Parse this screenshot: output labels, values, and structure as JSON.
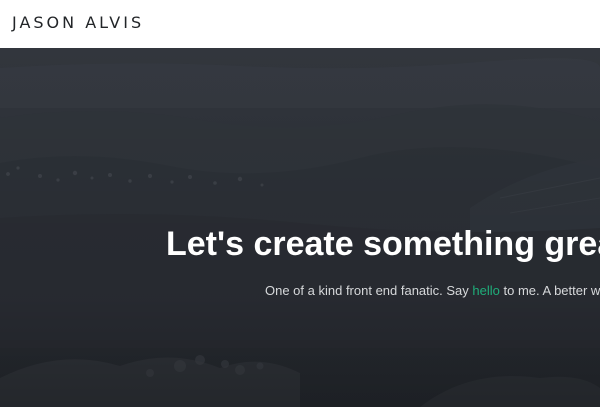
{
  "header": {
    "logo_text": "JASON ALVIS"
  },
  "hero": {
    "headline": "Let's create something grea",
    "tagline": {
      "before": "One of a kind front end fanatic. Say ",
      "link": "hello",
      "after": " to me. A better we"
    }
  },
  "colors": {
    "link": "#1fae7a",
    "hero_overlay": "#2b2f36",
    "header_bg": "#ffffff",
    "logo": "#222528"
  }
}
